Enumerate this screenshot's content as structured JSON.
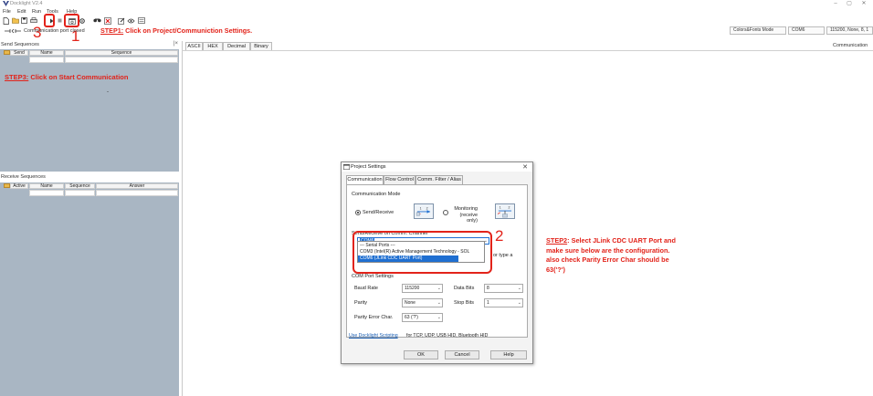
{
  "window": {
    "title": "Docklight V2.4",
    "minimize_label": "–",
    "maximize_label": "▢",
    "close_label": "✕"
  },
  "menu": [
    "File",
    "Edit",
    "Run",
    "Tools",
    "Help"
  ],
  "toolbar": {
    "icons": [
      "new-file-icon",
      "open-folder-icon",
      "save-icon",
      "print-icon",
      "start-communication-icon",
      "stop-communication-icon",
      "project-settings-icon",
      "settings-icon",
      "find-icon",
      "clear-icon",
      "edit-icon",
      "script-icon",
      "list-icon"
    ]
  },
  "status": {
    "connection_text": "Communication port closed",
    "colors_fonts_mode": "Colors&Fonts Mode",
    "port": "COM6",
    "baud_config": "115200, None, 8, 1",
    "mode": "Communication"
  },
  "annotations": {
    "step1_label": "STEP1:",
    "step1_text": " Click on Project/Communiction Settings.",
    "step2_label": "STEP2",
    "step2_line1": ": Select JLink CDC UART Port and",
    "step2_line2": "make sure below are the configuration.",
    "step2_line3": "also check Parity Error Char should be",
    "step2_line4": "63('?')",
    "step3_label": "STEP3:",
    "step3_text": "  Click on Start Communication",
    "marker_1": "1",
    "marker_2": "2",
    "marker_3": "3"
  },
  "send_sequences": {
    "title": "Send Sequences",
    "close_label": "|×",
    "columns": [
      "Send",
      "Name",
      "Sequence"
    ],
    "placeholder_dash": "-"
  },
  "receive_sequences": {
    "title": "Receive Sequences",
    "columns": [
      "Active",
      "Name",
      "Sequence",
      "Answer"
    ]
  },
  "view_tabs": [
    "ASCII",
    "HEX",
    "Decimal",
    "Binary"
  ],
  "dialog": {
    "title": "Project Settings",
    "close_label": "✕",
    "tabs": [
      "Communication",
      "Flow Control",
      "Comm. Filter / Alias"
    ],
    "mode_group_title": "Communication Mode",
    "mode_send_receive": "Send/Receive",
    "mode_monitoring": "Monitoring (receive only)",
    "channel_group_title": "Send/Receive on Comm. Channel",
    "channel_value": "COM6",
    "channel_hint": "or type a",
    "dropdown_items": [
      "--- Serial Ports ---",
      "COM3  (Intel(R) Active Management Technology - SOL",
      "COM6  (JLink CDC UART Port)"
    ],
    "port_settings_title": "COM Port Settings",
    "baud_label": "Baud Rate",
    "baud_value": "115200",
    "data_bits_label": "Data Bits",
    "data_bits_value": "8",
    "parity_label": "Parity",
    "parity_value": "None",
    "stop_bits_label": "Stop Bits",
    "stop_bits_value": "1",
    "parity_error_label": "Parity Error Char.",
    "parity_error_value": "63 ('?')",
    "scripting_link": "Use Docklight Scripting",
    "scripting_text": "for TCP, UDP, USB HID, Bluetooth HID",
    "ok_label": "OK",
    "cancel_label": "Cancel",
    "help_label": "Help"
  },
  "colors": {
    "accent_red": "#e2231a",
    "grid_bg": "#a9b6c3",
    "selection_blue": "#1f6fd1"
  }
}
